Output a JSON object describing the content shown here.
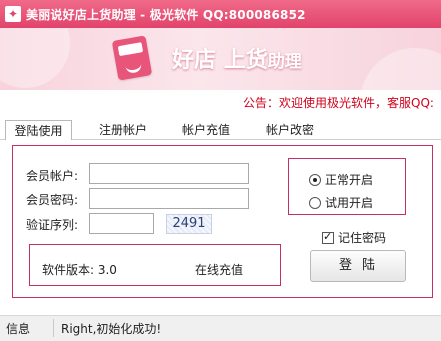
{
  "window": {
    "title": "美丽说好店上货助理 - 极光软件 QQ:800086852",
    "icon": "app-logo-icon"
  },
  "banner": {
    "title_part1": "好店",
    "title_part2": "上货",
    "title_part3": "助理",
    "logo": "shopping-bag-icon"
  },
  "notice": "公告：欢迎使用极光软件，客服QQ:",
  "tabs": [
    {
      "label": "登陆使用",
      "active": true
    },
    {
      "label": "注册帐户",
      "active": false
    },
    {
      "label": "帐户充值",
      "active": false
    },
    {
      "label": "帐户改密",
      "active": false
    }
  ],
  "form": {
    "account_label": "会员帐户:",
    "account_value": "",
    "password_label": "会员密码:",
    "password_value": "",
    "verify_label": "验证序列:",
    "verify_value": "",
    "captcha_text": "2491"
  },
  "mode": {
    "normal_label": "正常开启",
    "trial_label": "试用开启",
    "selected": "normal"
  },
  "remember": {
    "label": "记住密码",
    "checked": true
  },
  "info": {
    "version_text": "软件版本: 3.0",
    "recharge_label": "在线充值"
  },
  "login_button": "登陆",
  "status": {
    "left": "信息",
    "message": "Right,初始化成功!"
  },
  "colors": {
    "titlebar": "#e2436a",
    "accent_border": "#c2306a",
    "notice": "#d0021b",
    "banner_bg": "#f8d2dc"
  }
}
